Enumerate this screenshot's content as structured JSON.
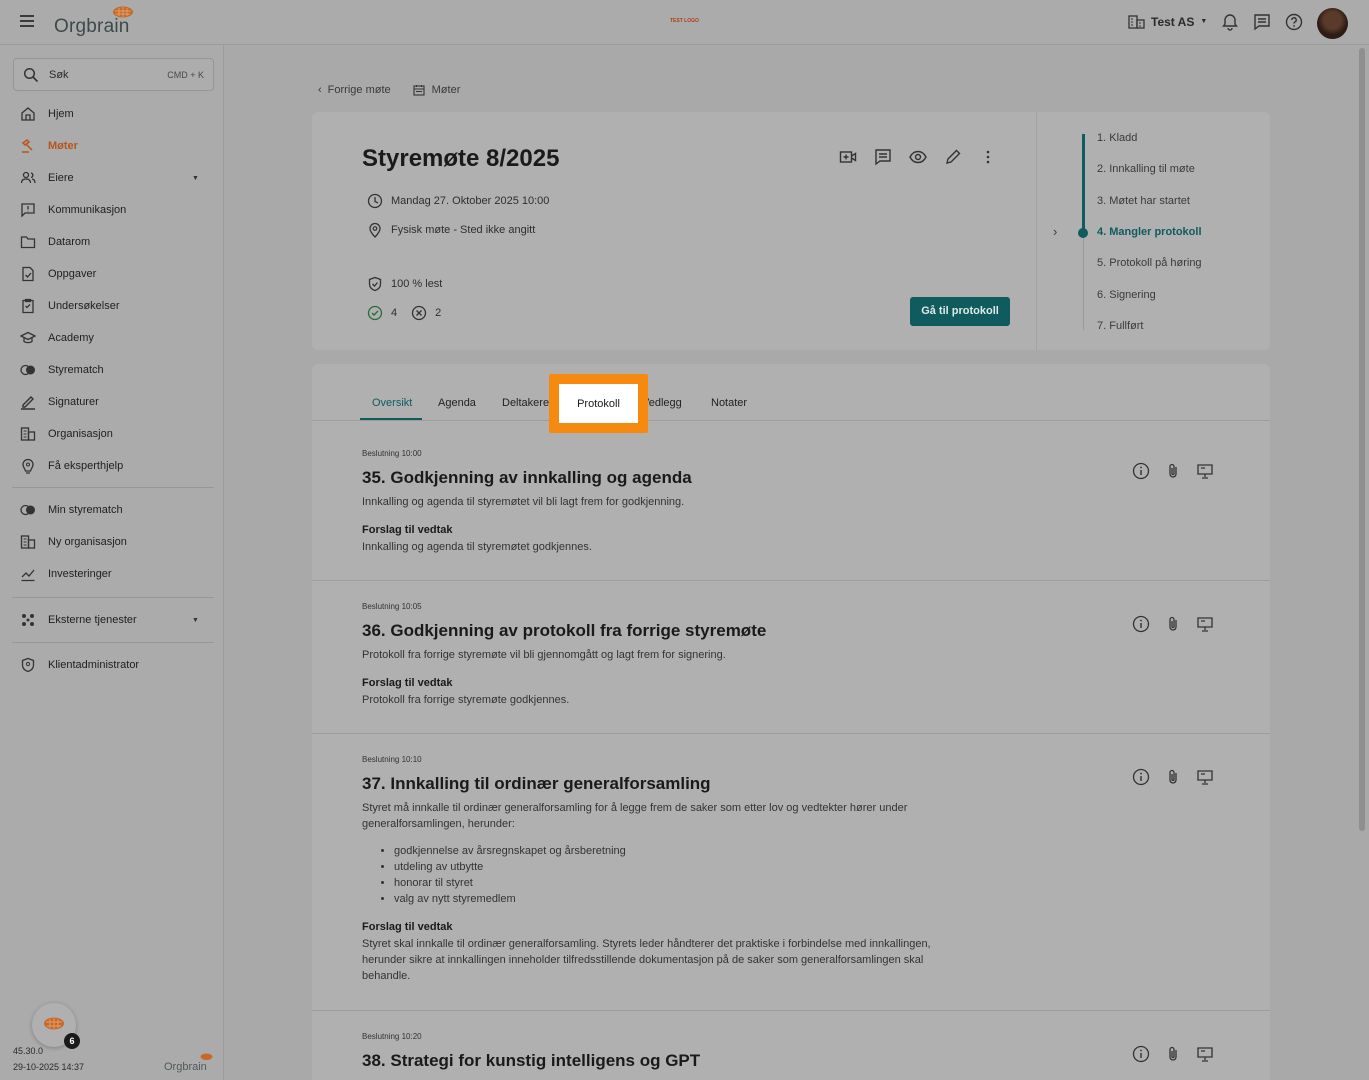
{
  "topbar": {
    "logo_text": "Orgbrain",
    "center_logo": "TEST LOGO",
    "org_name": "Test AS"
  },
  "sidebar": {
    "search_label": "Søk",
    "search_shortcut": "CMD + K",
    "items": [
      {
        "label": "Hjem",
        "icon": "home-icon"
      },
      {
        "label": "Møter",
        "icon": "gavel-icon"
      },
      {
        "label": "Eiere",
        "icon": "people-icon"
      },
      {
        "label": "Kommunikasjon",
        "icon": "message-icon"
      },
      {
        "label": "Datarom",
        "icon": "folder-icon"
      },
      {
        "label": "Oppgaver",
        "icon": "task-icon"
      },
      {
        "label": "Undersøkelser",
        "icon": "survey-icon"
      },
      {
        "label": "Academy",
        "icon": "academy-icon"
      },
      {
        "label": "Styrematch",
        "icon": "match-icon"
      },
      {
        "label": "Signaturer",
        "icon": "signature-icon"
      },
      {
        "label": "Organisasjon",
        "icon": "building-icon"
      },
      {
        "label": "Få eksperthjelp",
        "icon": "expert-icon"
      }
    ],
    "secondary_items": [
      {
        "label": "Min styrematch",
        "icon": "match-icon"
      },
      {
        "label": "Ny organisasjon",
        "icon": "building-add-icon"
      },
      {
        "label": "Investeringer",
        "icon": "chart-icon"
      }
    ],
    "external_label": "Eksterne tjenester",
    "admin_label": "Klientadministrator",
    "notification_count": "6",
    "version": "45.30.0",
    "build_date": "29-10-2025 14:37",
    "footer_logo": "Orgbrain"
  },
  "breadcrumb": {
    "back_label": "Forrige møte",
    "meetings_label": "Møter"
  },
  "meeting": {
    "title": "Styremøte 8/2025",
    "datetime": "Mandag 27. Oktober 2025 10:00",
    "location": "Fysisk møte - Sted ikke angitt",
    "read_status": "100 % lest",
    "accepted_count": "4",
    "declined_count": "2",
    "goto_button": "Gå til protokoll",
    "steps": [
      "1. Kladd",
      "2. Innkalling til møte",
      "3. Møtet har startet",
      "4. Mangler protokoll",
      "5. Protokoll på høring",
      "6. Signering",
      "7. Fullført"
    ],
    "current_step": 4
  },
  "tabs": [
    "Oversikt",
    "Agenda",
    "Deltakere",
    "Protokoll",
    "Vedlegg",
    "Notater"
  ],
  "agenda_items": [
    {
      "time": "Beslutning 10:00",
      "title": "35. Godkjenning av innkalling og agenda",
      "description": "Innkalling og agenda til styremøtet vil bli lagt frem for godkjenning.",
      "proposal_label": "Forslag til vedtak",
      "proposal": "Innkalling og agenda til styremøtet godkjennes."
    },
    {
      "time": "Beslutning 10:05",
      "title": "36. Godkjenning av protokoll fra forrige styremøte",
      "description": "Protokoll fra forrige styremøte vil bli gjennomgått og lagt frem for signering.",
      "proposal_label": "Forslag til vedtak",
      "proposal": "Protokoll fra forrige styremøte godkjennes."
    },
    {
      "time": "Beslutning 10:10",
      "title": "37. Innkalling til ordinær generalforsamling",
      "description": "Styret må innkalle til ordinær generalforsamling for å legge frem de saker som etter lov og vedtekter hører under generalforsamlingen, herunder:",
      "bullets": [
        "godkjennelse av årsregnskapet og årsberetning",
        "utdeling av utbytte",
        "honorar til styret",
        "valg av nytt styremedlem"
      ],
      "proposal_label": "Forslag til vedtak",
      "proposal": "Styret skal innkalle til ordinær generalforsamling. Styrets leder håndterer det praktiske i forbindelse med innkallingen, herunder sikre at innkallingen inneholder tilfredsstillende dokumentasjon på de saker som generalforsamlingen skal behandle."
    },
    {
      "time": "Beslutning 10:20",
      "title": "38. Strategi for kunstig intelligens og GPT"
    }
  ],
  "colors": {
    "accent": "#0f5b5e",
    "active_nav": "#b8541c",
    "highlight": "#f58a0e"
  }
}
